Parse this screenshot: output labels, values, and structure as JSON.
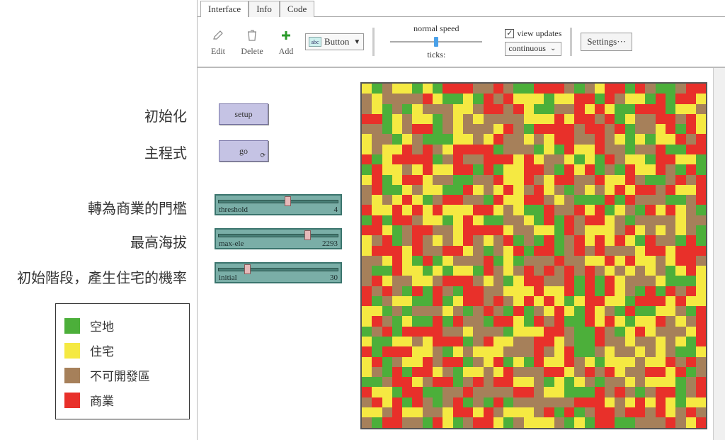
{
  "left": {
    "labels": {
      "init": "初始化",
      "main": "主程式",
      "threshold": "轉為商業的門檻",
      "maxele": "最高海拔",
      "initial": "初始階段，產生住宅的機率"
    },
    "legend": [
      {
        "color": "#4caf3a",
        "label": "空地"
      },
      {
        "color": "#f5e942",
        "label": "住宅"
      },
      {
        "color": "#a6805a",
        "label": "不可開發區"
      },
      {
        "color": "#e8302a",
        "label": "商業"
      }
    ]
  },
  "tabs": [
    "Interface",
    "Info",
    "Code"
  ],
  "active_tab": 0,
  "toolbar": {
    "edit": "Edit",
    "delete": "Delete",
    "add": "Add",
    "insert_label": "Button",
    "speed_top": "normal speed",
    "speed_bottom": "ticks:",
    "view_updates": "view updates",
    "update_mode": "continuous",
    "settings": "Settings···"
  },
  "buttons": {
    "setup": "setup",
    "go": "go"
  },
  "sliders": [
    {
      "name": "threshold",
      "value": "4",
      "thumb_pct": 55
    },
    {
      "name": "max-ele",
      "value": "2293",
      "thumb_pct": 72
    },
    {
      "name": "initial",
      "value": "30",
      "thumb_pct": 22
    }
  ],
  "world": {
    "seed": 42,
    "cols": 34,
    "rows": 34,
    "colors": [
      "#4caf3a",
      "#f5e942",
      "#a6805a",
      "#e8302a"
    ]
  }
}
